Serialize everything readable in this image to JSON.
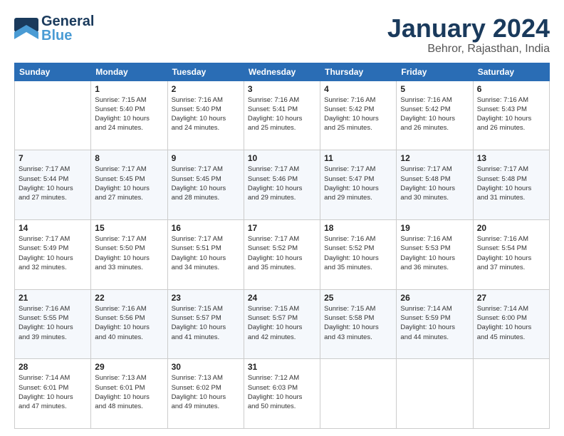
{
  "header": {
    "logo": {
      "line1": "General",
      "line2": "Blue"
    },
    "title": "January 2024",
    "location": "Behror, Rajasthan, India"
  },
  "days_of_week": [
    "Sunday",
    "Monday",
    "Tuesday",
    "Wednesday",
    "Thursday",
    "Friday",
    "Saturday"
  ],
  "weeks": [
    [
      {
        "day": "",
        "info": ""
      },
      {
        "day": "1",
        "info": "Sunrise: 7:15 AM\nSunset: 5:40 PM\nDaylight: 10 hours\nand 24 minutes."
      },
      {
        "day": "2",
        "info": "Sunrise: 7:16 AM\nSunset: 5:40 PM\nDaylight: 10 hours\nand 24 minutes."
      },
      {
        "day": "3",
        "info": "Sunrise: 7:16 AM\nSunset: 5:41 PM\nDaylight: 10 hours\nand 25 minutes."
      },
      {
        "day": "4",
        "info": "Sunrise: 7:16 AM\nSunset: 5:42 PM\nDaylight: 10 hours\nand 25 minutes."
      },
      {
        "day": "5",
        "info": "Sunrise: 7:16 AM\nSunset: 5:42 PM\nDaylight: 10 hours\nand 26 minutes."
      },
      {
        "day": "6",
        "info": "Sunrise: 7:16 AM\nSunset: 5:43 PM\nDaylight: 10 hours\nand 26 minutes."
      }
    ],
    [
      {
        "day": "7",
        "info": "Sunrise: 7:17 AM\nSunset: 5:44 PM\nDaylight: 10 hours\nand 27 minutes."
      },
      {
        "day": "8",
        "info": "Sunrise: 7:17 AM\nSunset: 5:45 PM\nDaylight: 10 hours\nand 27 minutes."
      },
      {
        "day": "9",
        "info": "Sunrise: 7:17 AM\nSunset: 5:45 PM\nDaylight: 10 hours\nand 28 minutes."
      },
      {
        "day": "10",
        "info": "Sunrise: 7:17 AM\nSunset: 5:46 PM\nDaylight: 10 hours\nand 29 minutes."
      },
      {
        "day": "11",
        "info": "Sunrise: 7:17 AM\nSunset: 5:47 PM\nDaylight: 10 hours\nand 29 minutes."
      },
      {
        "day": "12",
        "info": "Sunrise: 7:17 AM\nSunset: 5:48 PM\nDaylight: 10 hours\nand 30 minutes."
      },
      {
        "day": "13",
        "info": "Sunrise: 7:17 AM\nSunset: 5:48 PM\nDaylight: 10 hours\nand 31 minutes."
      }
    ],
    [
      {
        "day": "14",
        "info": "Sunrise: 7:17 AM\nSunset: 5:49 PM\nDaylight: 10 hours\nand 32 minutes."
      },
      {
        "day": "15",
        "info": "Sunrise: 7:17 AM\nSunset: 5:50 PM\nDaylight: 10 hours\nand 33 minutes."
      },
      {
        "day": "16",
        "info": "Sunrise: 7:17 AM\nSunset: 5:51 PM\nDaylight: 10 hours\nand 34 minutes."
      },
      {
        "day": "17",
        "info": "Sunrise: 7:17 AM\nSunset: 5:52 PM\nDaylight: 10 hours\nand 35 minutes."
      },
      {
        "day": "18",
        "info": "Sunrise: 7:16 AM\nSunset: 5:52 PM\nDaylight: 10 hours\nand 35 minutes."
      },
      {
        "day": "19",
        "info": "Sunrise: 7:16 AM\nSunset: 5:53 PM\nDaylight: 10 hours\nand 36 minutes."
      },
      {
        "day": "20",
        "info": "Sunrise: 7:16 AM\nSunset: 5:54 PM\nDaylight: 10 hours\nand 37 minutes."
      }
    ],
    [
      {
        "day": "21",
        "info": "Sunrise: 7:16 AM\nSunset: 5:55 PM\nDaylight: 10 hours\nand 39 minutes."
      },
      {
        "day": "22",
        "info": "Sunrise: 7:16 AM\nSunset: 5:56 PM\nDaylight: 10 hours\nand 40 minutes."
      },
      {
        "day": "23",
        "info": "Sunrise: 7:15 AM\nSunset: 5:57 PM\nDaylight: 10 hours\nand 41 minutes."
      },
      {
        "day": "24",
        "info": "Sunrise: 7:15 AM\nSunset: 5:57 PM\nDaylight: 10 hours\nand 42 minutes."
      },
      {
        "day": "25",
        "info": "Sunrise: 7:15 AM\nSunset: 5:58 PM\nDaylight: 10 hours\nand 43 minutes."
      },
      {
        "day": "26",
        "info": "Sunrise: 7:14 AM\nSunset: 5:59 PM\nDaylight: 10 hours\nand 44 minutes."
      },
      {
        "day": "27",
        "info": "Sunrise: 7:14 AM\nSunset: 6:00 PM\nDaylight: 10 hours\nand 45 minutes."
      }
    ],
    [
      {
        "day": "28",
        "info": "Sunrise: 7:14 AM\nSunset: 6:01 PM\nDaylight: 10 hours\nand 47 minutes."
      },
      {
        "day": "29",
        "info": "Sunrise: 7:13 AM\nSunset: 6:01 PM\nDaylight: 10 hours\nand 48 minutes."
      },
      {
        "day": "30",
        "info": "Sunrise: 7:13 AM\nSunset: 6:02 PM\nDaylight: 10 hours\nand 49 minutes."
      },
      {
        "day": "31",
        "info": "Sunrise: 7:12 AM\nSunset: 6:03 PM\nDaylight: 10 hours\nand 50 minutes."
      },
      {
        "day": "",
        "info": ""
      },
      {
        "day": "",
        "info": ""
      },
      {
        "day": "",
        "info": ""
      }
    ]
  ]
}
